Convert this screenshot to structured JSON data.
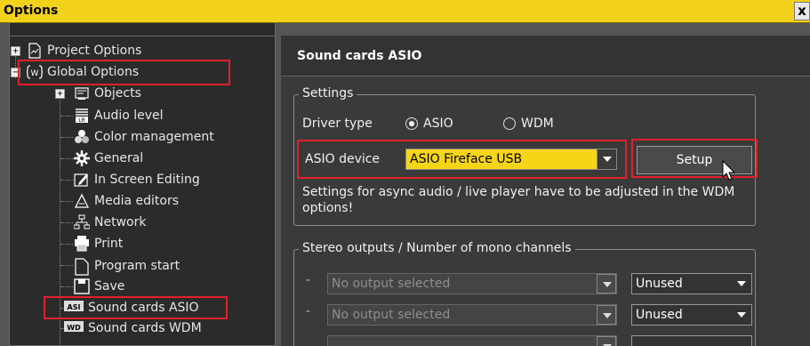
{
  "window": {
    "title": "Options",
    "close_label": "x"
  },
  "tree": {
    "project_options": "Project Options",
    "global_options": "Global Options",
    "items": [
      {
        "label": "Objects",
        "icon": "objects-icon"
      },
      {
        "label": "Audio level",
        "icon": "audio-level-icon"
      },
      {
        "label": "Color management",
        "icon": "color-management-icon"
      },
      {
        "label": "General",
        "icon": "gear-icon"
      },
      {
        "label": "In Screen Editing",
        "icon": "edit-icon"
      },
      {
        "label": "Media editors",
        "icon": "media-editors-icon"
      },
      {
        "label": "Network",
        "icon": "network-icon"
      },
      {
        "label": "Print",
        "icon": "printer-icon"
      },
      {
        "label": "Program start",
        "icon": "document-icon"
      },
      {
        "label": "Save",
        "icon": "save-icon"
      },
      {
        "label": "Sound cards ASIO",
        "icon": "asio-icon"
      },
      {
        "label": "Sound cards WDM",
        "icon": "wdm-icon"
      }
    ]
  },
  "panel": {
    "header": "Sound cards ASIO",
    "settings": {
      "legend": "Settings",
      "driver_type_label": "Driver type",
      "driver_options": [
        "ASIO",
        "WDM"
      ],
      "selected_driver": "ASIO",
      "asio_device_label": "ASIO device",
      "asio_device_value": "ASIO Fireface USB",
      "setup_label": "Setup",
      "note": "Settings for async audio / live player have to be adjusted in the WDM options!"
    },
    "stereo": {
      "legend": "Stereo outputs / Number of mono channels",
      "rows": [
        {
          "dash": "-",
          "output": "No output selected",
          "channels": "Unused"
        },
        {
          "dash": "-",
          "output": "No output selected",
          "channels": "Unused"
        }
      ]
    }
  },
  "colors": {
    "title_bar": "#f2d21a",
    "highlight_red": "#e0202a",
    "combo_yellow": "#f5d515"
  }
}
